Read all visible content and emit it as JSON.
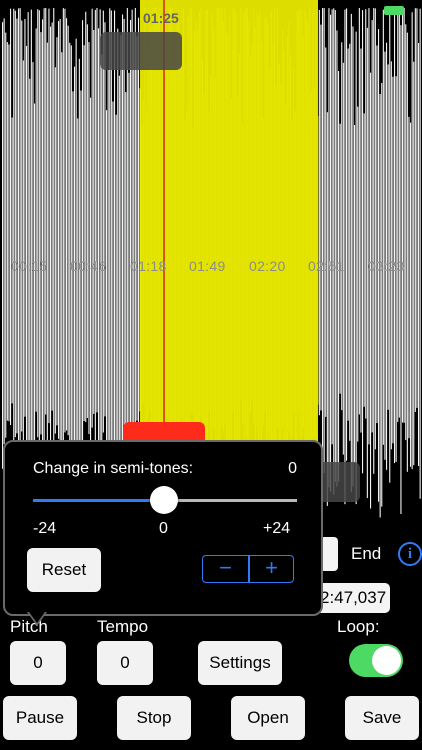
{
  "status_bar": {
    "clock": "01:25"
  },
  "timeline": {
    "labels": [
      "00:15",
      "00:46",
      "01:18",
      "01:49",
      "02:20",
      "02:51",
      "03:23"
    ]
  },
  "end_section": {
    "end_label": "End",
    "end_time": "2:47,037",
    "info_icon": "info-icon"
  },
  "controls": {
    "pitch_label": "Pitch",
    "tempo_label": "Tempo",
    "loop_label": "Loop:",
    "pitch_value": "0",
    "tempo_value": "0",
    "settings_label": "Settings",
    "loop_enabled": true
  },
  "transport": {
    "pause": "Pause",
    "stop": "Stop",
    "open": "Open",
    "save": "Save"
  },
  "popover": {
    "title": "Change in semi-tones:",
    "value": "0",
    "slider": {
      "min": "-24",
      "mid": "0",
      "max": "+24",
      "value": 0
    },
    "reset_label": "Reset",
    "minus": "−",
    "plus": "+"
  },
  "colors": {
    "selection": "#f0f000",
    "waveform": "#f4f4f4",
    "playhead": "#e0201a",
    "accent": "#2f7cf6",
    "toggle_on": "#4cd964"
  }
}
